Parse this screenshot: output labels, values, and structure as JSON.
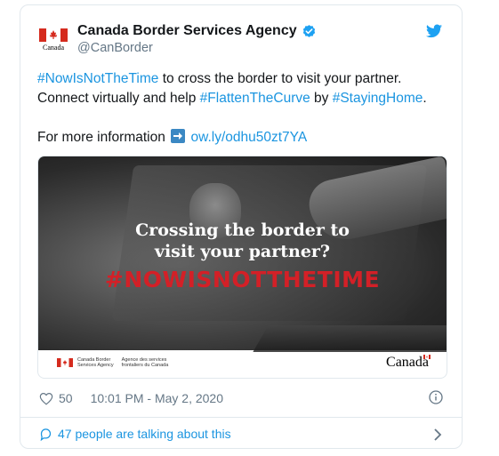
{
  "author": {
    "name": "Canada Border Services Agency",
    "handle": "@CanBorder",
    "avatar_caption": "Canada"
  },
  "tweet": {
    "hashtag1": "#NowIsNotTheTime",
    "text1": " to cross the border to visit your partner.",
    "text2": "Connect virtually and help ",
    "hashtag2": "#FlattenTheCurve",
    "text3": " by ",
    "hashtag3": "#StayingHome",
    "text4": ".",
    "info_prefix": "For more information ",
    "link": "ow.ly/odhu50zt7YA"
  },
  "media": {
    "headline_line1": "Crossing the border to",
    "headline_line2": "visit your partner?",
    "hashtag": "#NOWISNOTTHETIME",
    "agency_en_1": "Canada Border",
    "agency_en_2": "Services Agency",
    "agency_fr_1": "Agence des services",
    "agency_fr_2": "frontaliers du Canada",
    "wordmark": "Canada"
  },
  "meta": {
    "likes": "50",
    "timestamp": "10:01 PM - May 2, 2020"
  },
  "conversation": {
    "label": "47 people are talking about this"
  },
  "colors": {
    "link_blue": "#1b95e0",
    "hashtag_red": "#d32027",
    "meta_gray": "#657786"
  }
}
